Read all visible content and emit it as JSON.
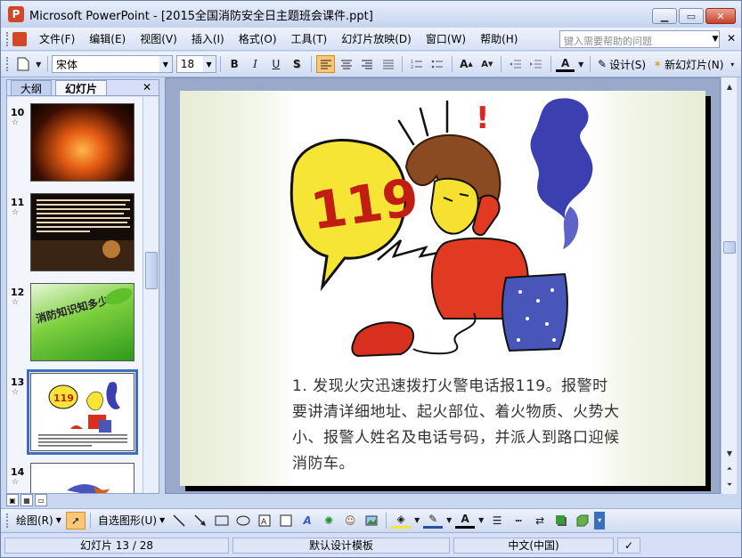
{
  "window": {
    "title": "Microsoft PowerPoint - [2015全国消防安全日主题班会课件.ppt]",
    "app_icon_glyph": "P",
    "btn_min": "▁",
    "btn_max": "▭",
    "btn_close": "✕"
  },
  "menu": {
    "items": [
      "文件(F)",
      "编辑(E)",
      "视图(V)",
      "插入(I)",
      "格式(O)",
      "工具(T)",
      "幻灯片放映(D)",
      "窗口(W)",
      "帮助(H)"
    ],
    "help_placeholder": "键入需要帮助的问题",
    "close_glyph": "✕"
  },
  "toolbar": {
    "font_name": "宋体",
    "font_size": "18",
    "bold": "B",
    "italic": "I",
    "underline": "U",
    "shadow": "S",
    "design_label": "设计(S)",
    "new_slide_label": "新幻灯片(N)"
  },
  "outline_pane": {
    "tab_outline": "大纲",
    "tab_slides": "幻灯片",
    "close_glyph": "✕",
    "thumbnails": [
      {
        "number": "10"
      },
      {
        "number": "11"
      },
      {
        "number": "12",
        "caption": "消防知识知多少"
      },
      {
        "number": "13",
        "selected": true
      },
      {
        "number": "14"
      }
    ]
  },
  "slide": {
    "bubble_number": "119",
    "body_text": "1. 发现火灾迅速拨打火警电话报119。报警时要讲清详细地址、起火部位、着火物质、火势大小、报警人姓名及电话号码，并派人到路口迎候消防车。"
  },
  "drawbar": {
    "draw_label": "绘图(R)",
    "autoshape_label": "自选图形(U)"
  },
  "status": {
    "slide_indicator": "幻灯片 13 / 28",
    "template": "默认设计模板",
    "language": "中文(中国)"
  },
  "colors": {
    "title_bg": "#c5d4ee",
    "selected_thumb": "#3d6fbf",
    "bubble_yellow": "#f7e536",
    "phone_red": "#d7301f",
    "smoke_blue": "#3b3fb0"
  }
}
